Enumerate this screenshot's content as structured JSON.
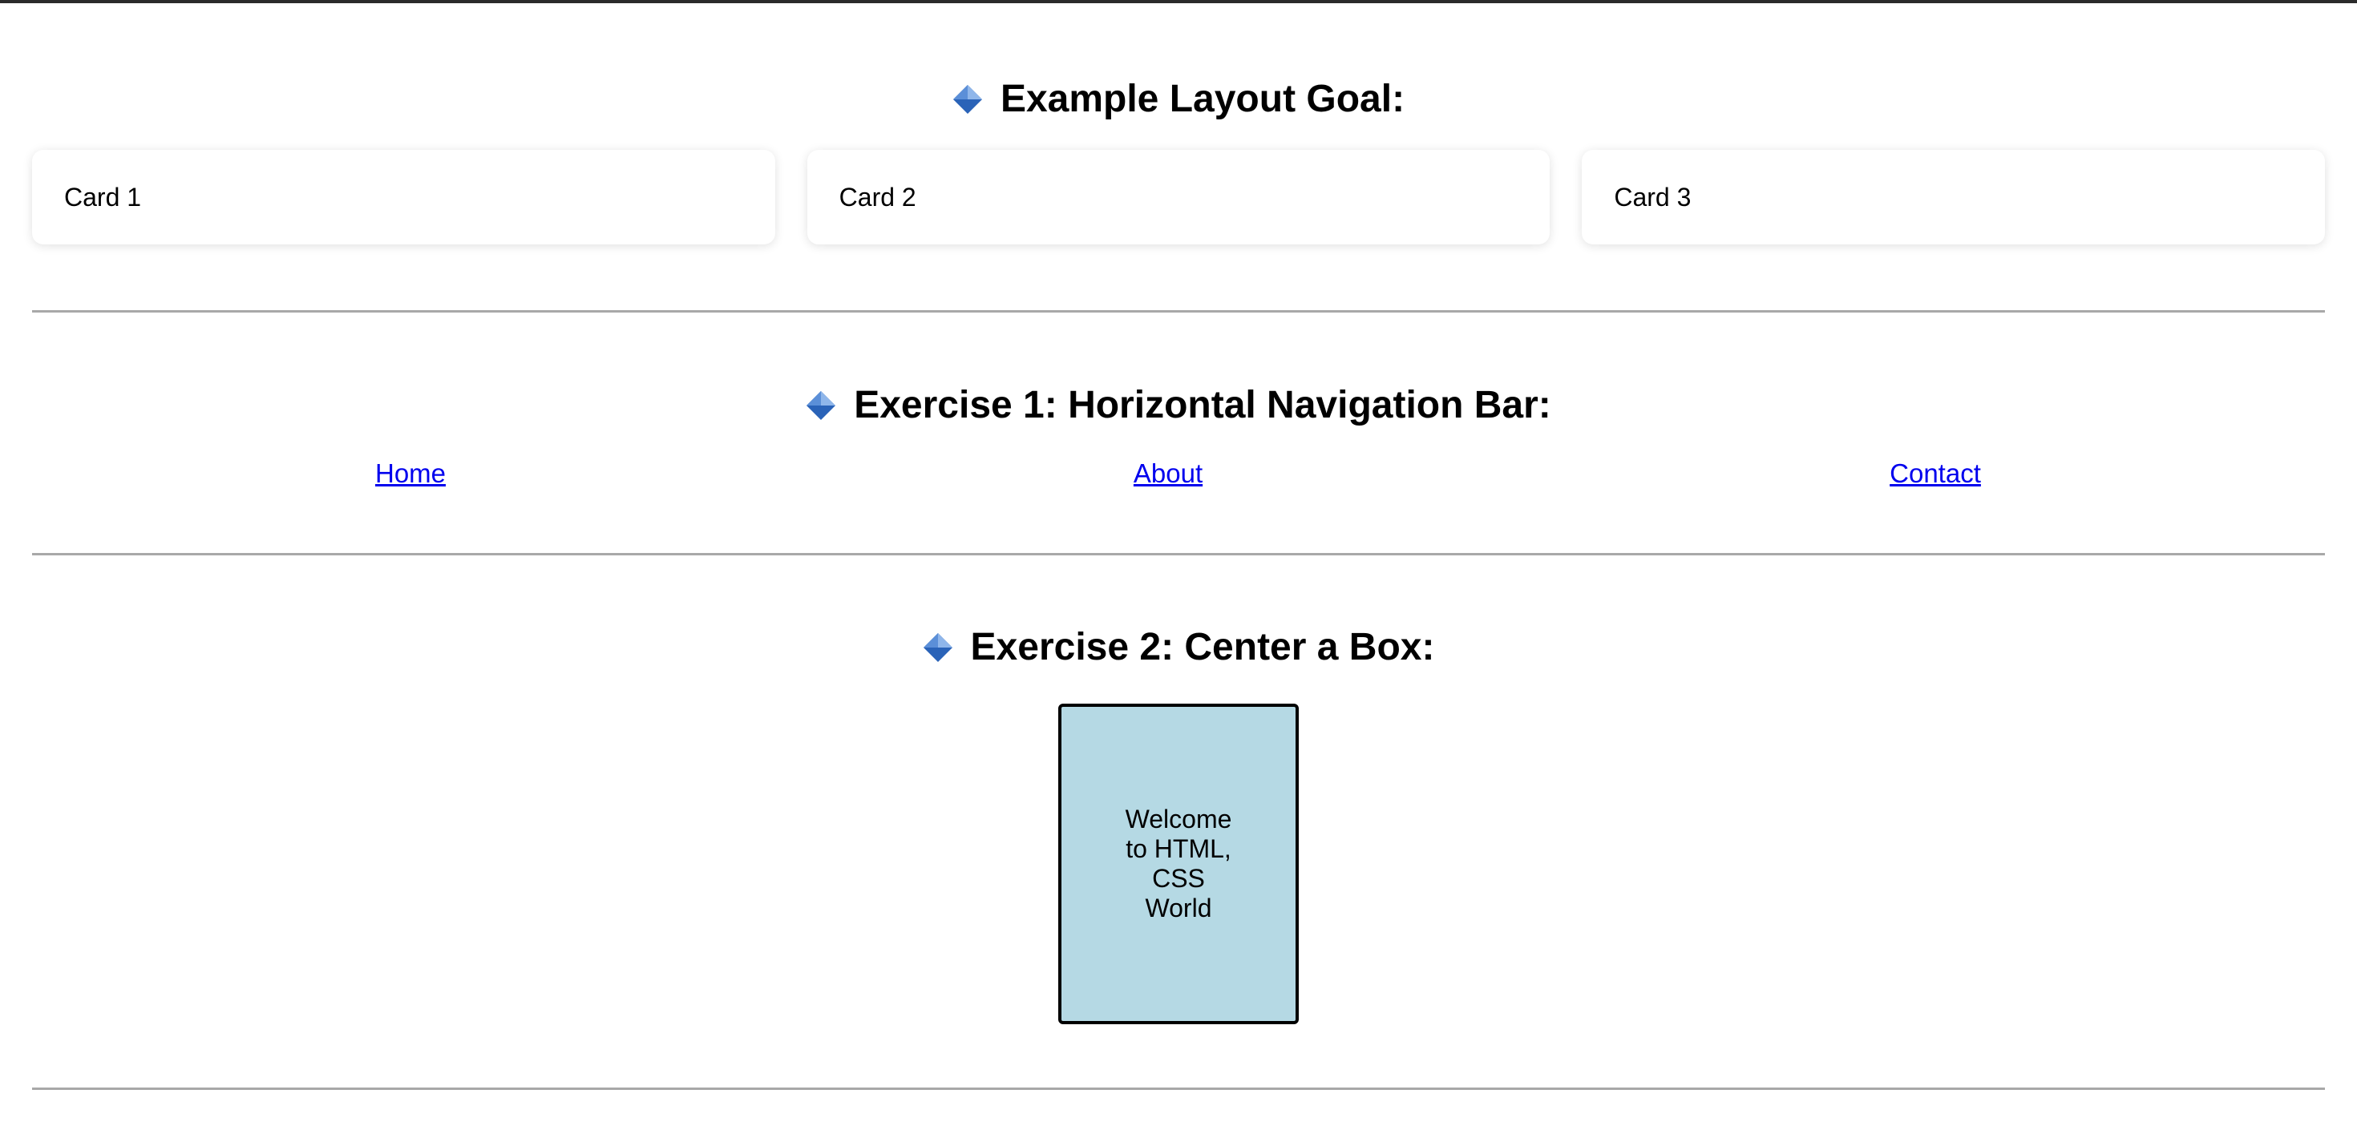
{
  "colors": {
    "diamond_light": "#8fb6ea",
    "diamond_dark": "#2a63b8",
    "link": "#0000ee",
    "box_fill": "#b5d9e4",
    "divider": "#a8a8a8"
  },
  "icons": {
    "heading_marker": "blue-diamond-icon"
  },
  "layout_goal": {
    "heading": "Example Layout Goal:",
    "cards": [
      {
        "label": "Card 1"
      },
      {
        "label": "Card 2"
      },
      {
        "label": "Card 3"
      }
    ]
  },
  "exercise1": {
    "heading": "Exercise 1: Horizontal Navigation Bar:",
    "links": [
      {
        "label": "Home"
      },
      {
        "label": "About"
      },
      {
        "label": "Contact"
      }
    ]
  },
  "exercise2": {
    "heading": "Exercise 2: Center a Box:",
    "box_text": "Welcome to HTML, CSS World"
  }
}
